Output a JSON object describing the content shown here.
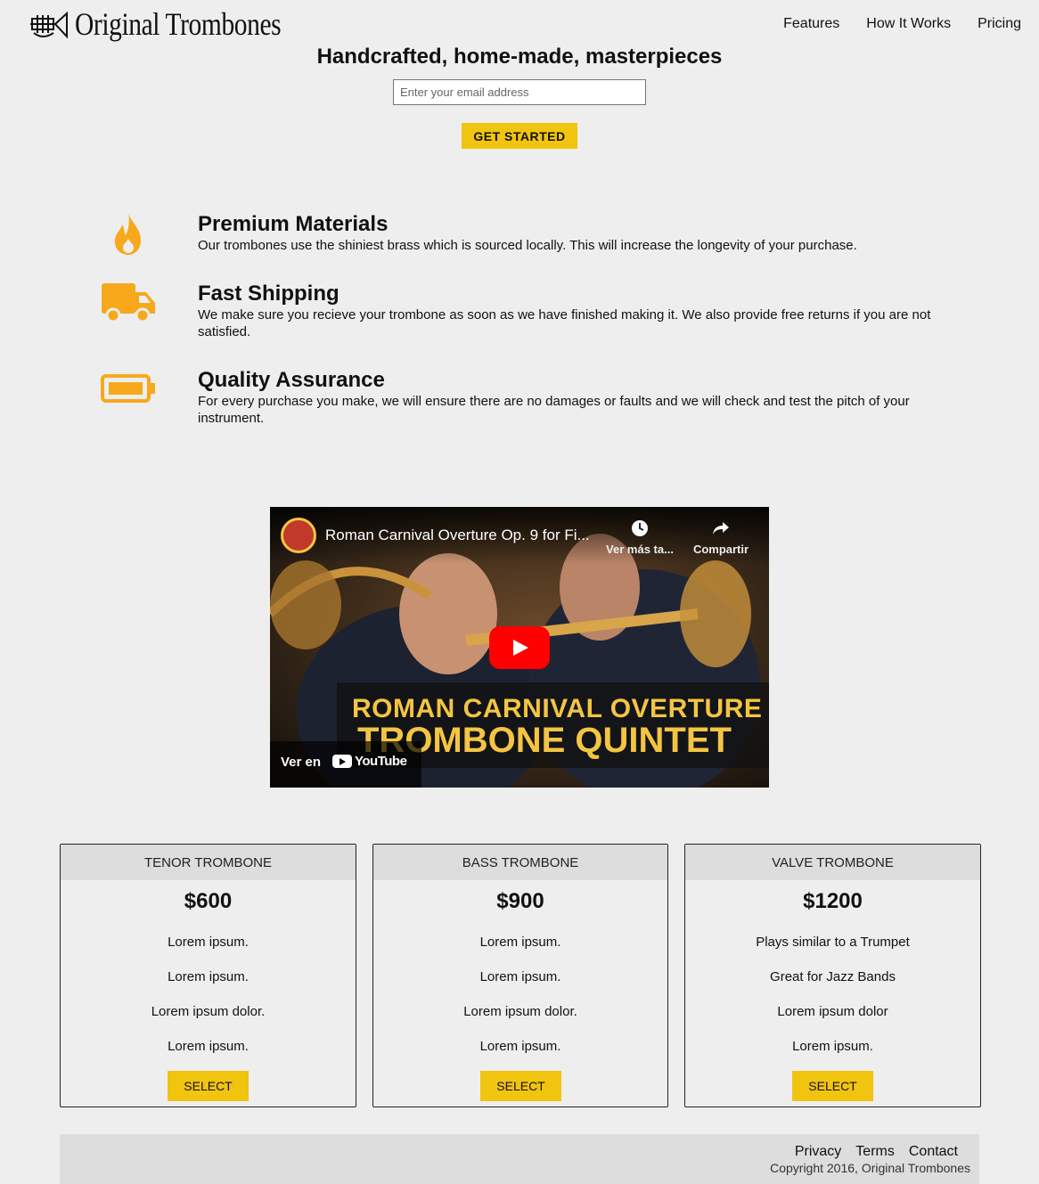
{
  "header": {
    "brand": "Original Trombones",
    "nav": [
      "Features",
      "How It Works",
      "Pricing"
    ]
  },
  "hero": {
    "title": "Handcrafted, home-made, masterpieces",
    "email_placeholder": "Enter your email address",
    "cta_label": "GET STARTED"
  },
  "features": [
    {
      "icon": "fire-icon",
      "title": "Premium Materials",
      "text": "Our trombones use the shiniest brass which is sourced locally. This will increase the longevity of your purchase."
    },
    {
      "icon": "truck-icon",
      "title": "Fast Shipping",
      "text": "We make sure you recieve your trombone as soon as we have finished making it. We also provide free returns if you are not satisfied."
    },
    {
      "icon": "battery-icon",
      "title": "Quality Assurance",
      "text": "For every purchase you make, we will ensure there are no damages or faults and we will check and test the pitch of your instrument."
    }
  ],
  "video": {
    "title": "Roman Carnival Overture Op. 9 for Fi...",
    "watch_later": "Ver más ta...",
    "share": "Compartir",
    "banner_line1": "ROMAN CARNIVAL OVERTURE",
    "banner_line2": "TROMBONE QUINTET",
    "watch_on": "Ver en",
    "youtube": "YouTube"
  },
  "pricing": [
    {
      "name": "TENOR TROMBONE",
      "price": "$600",
      "features": [
        "Lorem ipsum.",
        "Lorem ipsum.",
        "Lorem ipsum dolor.",
        "Lorem ipsum."
      ],
      "button": "SELECT"
    },
    {
      "name": "BASS TROMBONE",
      "price": "$900",
      "features": [
        "Lorem ipsum.",
        "Lorem ipsum.",
        "Lorem ipsum dolor.",
        "Lorem ipsum."
      ],
      "button": "SELECT"
    },
    {
      "name": "VALVE TROMBONE",
      "price": "$1200",
      "features": [
        "Plays similar to a Trumpet",
        "Great for Jazz Bands",
        "Lorem ipsum dolor",
        "Lorem ipsum."
      ],
      "button": "SELECT"
    }
  ],
  "footer": {
    "links": [
      "Privacy",
      "Terms",
      "Contact"
    ],
    "copyright": "Copyright 2016, Original Trombones"
  },
  "colors": {
    "accent": "#f1c40f",
    "icon_orange": "#f7a81b",
    "background": "#eeeeee"
  }
}
